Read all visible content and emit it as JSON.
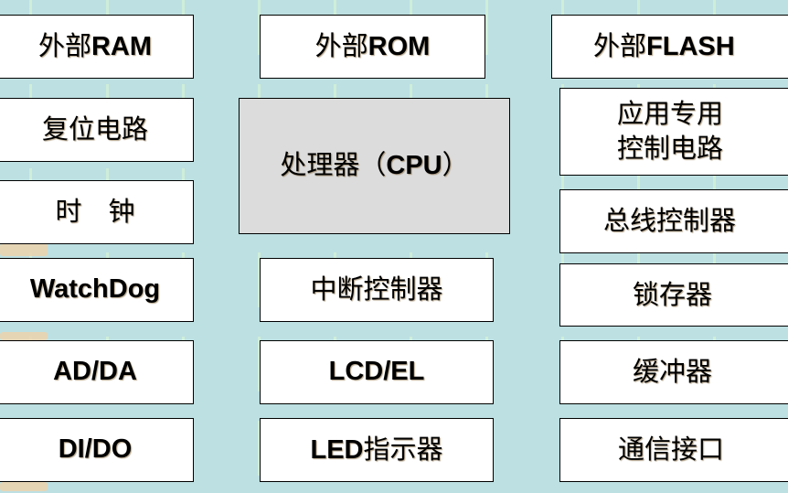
{
  "diagram": {
    "title": "",
    "colors": {
      "background": "#bde0e2",
      "box": "#ffffff",
      "cpu_box": "#dcdcdc",
      "border": "#000000"
    },
    "left_column": [
      {
        "cjk": "外部",
        "latin": "RAM"
      },
      {
        "cjk": "复位电路",
        "latin": ""
      },
      {
        "cjk": "时　钟",
        "latin": ""
      },
      {
        "cjk": "",
        "latin": "WatchDog"
      },
      {
        "cjk": "",
        "latin": "AD/DA"
      },
      {
        "cjk": "",
        "latin": "DI/DO"
      }
    ],
    "middle_column": [
      {
        "cjk": "外部",
        "latin": "ROM"
      },
      {
        "cjk": "处理器（",
        "latin": "CPU",
        "suffix": "）"
      },
      {
        "cjk": "中断控制器",
        "latin": ""
      },
      {
        "cjk": "",
        "latin": "LCD/EL"
      },
      {
        "latin": "LED",
        "cjk_after": "指示器"
      }
    ],
    "right_column": [
      {
        "cjk": "外部",
        "latin": "FLASH"
      },
      {
        "cjk": "应用专用\n控制电路",
        "latin": ""
      },
      {
        "cjk": "总线控制器",
        "latin": ""
      },
      {
        "cjk": "锁存器",
        "latin": ""
      },
      {
        "cjk": "缓冲器",
        "latin": ""
      },
      {
        "cjk": "通信接口",
        "latin": ""
      }
    ]
  }
}
